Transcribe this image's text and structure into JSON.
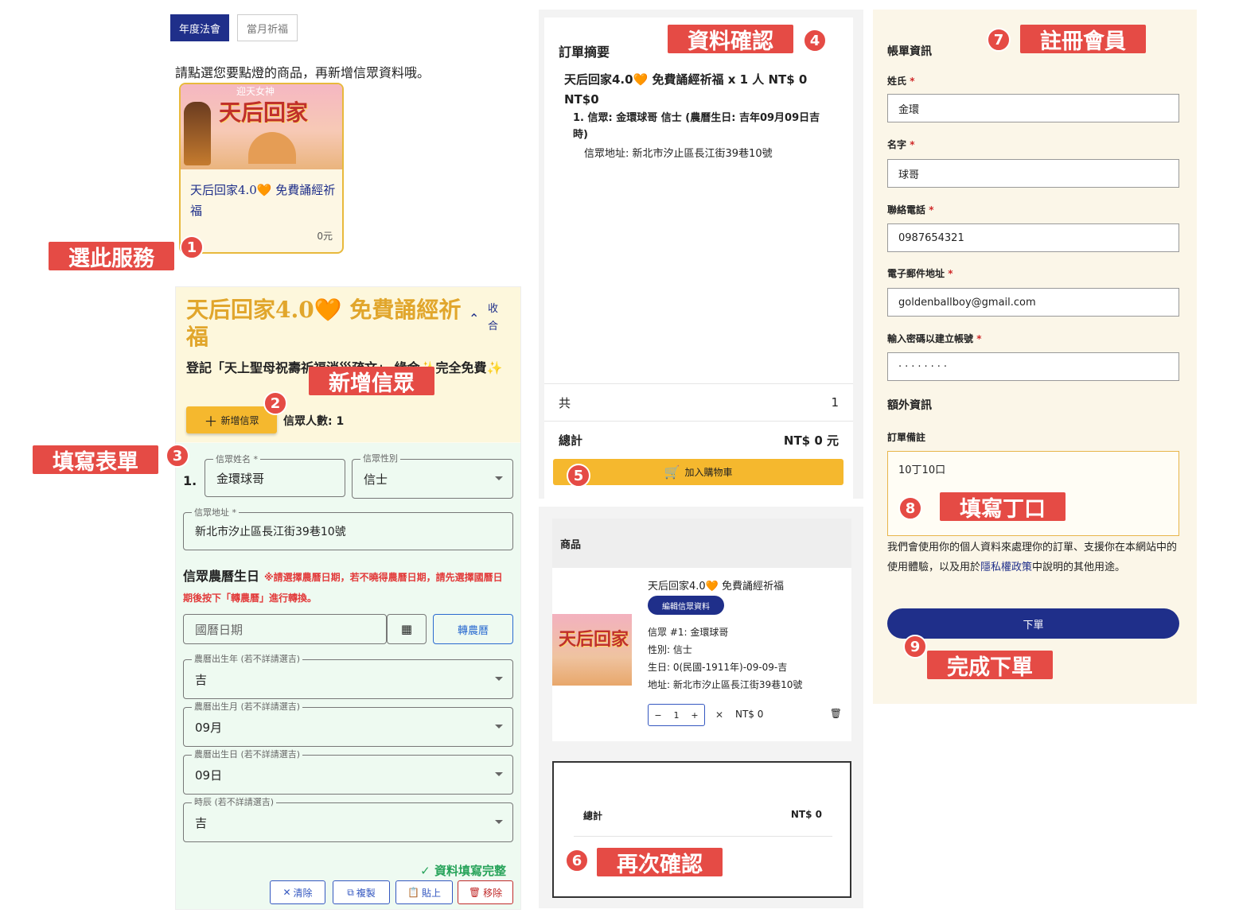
{
  "left": {
    "tabs": [
      "年度法會",
      "當月祈福"
    ],
    "instruction": "請點選您要點燈的商品，再新增信眾資料哦。",
    "product": {
      "name": "天后回家4.0🧡 免費誦經祈福",
      "price": "0元",
      "banner_text": "天后回家",
      "banner_small": "迎天女神"
    },
    "form": {
      "title": "天后回家4.0🧡 免費誦經祈福",
      "collapse_label": "收合",
      "description": "登記「天上聖母祝壽祈福消災疏文」 緣金✨完全免費✨",
      "add_button": "新增信眾",
      "count_label": "信眾人數: 1",
      "row_number": "1.",
      "name_label": "信眾姓名 *",
      "name_value": "金環球哥",
      "gender_label": "信眾性別",
      "gender_value": "信士",
      "address_label": "信眾地址 *",
      "address_value": "新北市汐止區長江街39巷10號",
      "lunar_title": "信眾農曆生日",
      "lunar_note": "※請選擇農曆日期，若不曉得農曆日期，請先選擇國曆日期後按下「轉農曆」進行轉換。",
      "solar_placeholder": "國曆日期",
      "convert_button": "轉農曆",
      "year_label": "農曆出生年 (若不詳請選吉)",
      "year_value": "吉",
      "month_label": "農曆出生月 (若不詳請選吉)",
      "month_value": "09月",
      "day_label": "農曆出生日 (若不詳請選吉)",
      "day_value": "09日",
      "hour_label": "時辰 (若不詳請選吉)",
      "hour_value": "吉",
      "complete_text": "資料填寫完整",
      "buttons": {
        "clear": "清除",
        "copy": "複製",
        "paste": "貼上",
        "remove": "移除"
      }
    }
  },
  "summary": {
    "title": "訂單摘要",
    "line": "天后回家4.0🧡 免費誦經祈福 x 1 人 NT$ 0 NT$0",
    "detail": "1. 信眾: 金環球哥 信士 (農曆生日: 吉年09月09日吉時)",
    "address": "信眾地址: 新北市汐止區長江街39巷10號",
    "count_label": "共",
    "count_value": "1",
    "total_label": "總計",
    "total_value": "NT$ 0 元",
    "cart_button": "加入購物車"
  },
  "cart": {
    "header": "商品",
    "item_name": "天后回家4.0🧡 免費誦經祈福",
    "edit_button": "編輯信眾資料",
    "believer": "信眾 #1: 金環球哥",
    "gender": "性別: 信士",
    "birthday": "生日: 0(民國-1911年)-09-09-吉",
    "address": "地址: 新北市汐止區長江街39巷10號",
    "qty": "1",
    "price": "NT$ 0",
    "thumb_text": "天后回家",
    "total_label": "總計",
    "total_value": "NT$ 0"
  },
  "register": {
    "billing_title": "帳單資訊",
    "lastname_label": "姓氏",
    "lastname_value": "金環",
    "firstname_label": "名字",
    "firstname_value": "球哥",
    "phone_label": "聯絡電話",
    "phone_value": "0987654321",
    "email_label": "電子郵件地址",
    "email_value": "goldenballboy@gmail.com",
    "password_label": "輸入密碼以建立帳號",
    "password_value": "········",
    "extra_title": "額外資訊",
    "notes_label": "訂單備註",
    "notes_value": "10丁10口",
    "privacy_pre": "我們會使用你的個人資料來處理你的訂單、支援你在本網站中的使用體驗，以及用於",
    "privacy_link": "隱私權政策",
    "privacy_post": "中說明的其他用途。",
    "order_button": "下單"
  },
  "annotations": {
    "n1": "1",
    "t1": "選此服務",
    "n2": "2",
    "t2": "新增信眾",
    "n3": "3",
    "t3": "填寫表單",
    "n4": "4",
    "t4": "資料確認",
    "n5": "5",
    "n6": "6",
    "t6": "再次確認",
    "n7": "7",
    "t7": "註冊會員",
    "n8": "8",
    "t8": "填寫丁口",
    "n9": "9",
    "t9": "完成下單"
  },
  "colors": {
    "navy": "#1f2f8a",
    "gold": "#f5b82e",
    "annotation_red": "#e54b45",
    "success_green": "#27a35a"
  }
}
